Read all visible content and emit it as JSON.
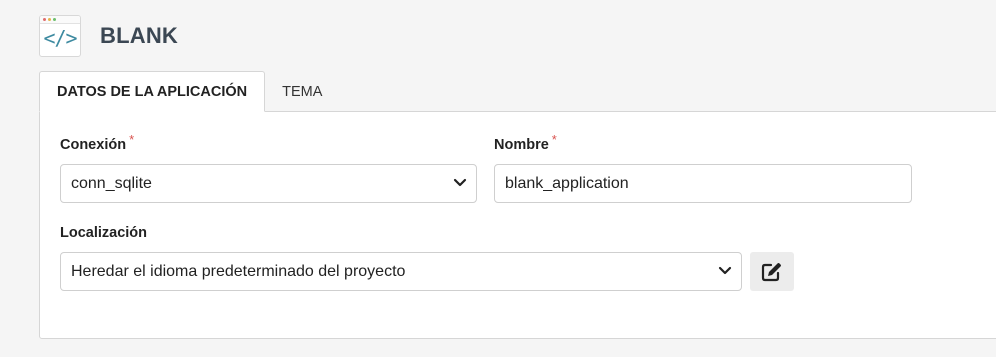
{
  "app": {
    "title": "BLANK",
    "icon": "code-brackets-icon",
    "icon_glyph": "</>"
  },
  "tabs": [
    {
      "label": "DATOS DE LA APLICACIÓN",
      "active": true
    },
    {
      "label": "TEMA",
      "active": false
    }
  ],
  "form": {
    "connection": {
      "label": "Conexión",
      "required": "*",
      "value": "conn_sqlite"
    },
    "name": {
      "label": "Nombre",
      "required": "*",
      "value": "blank_application"
    },
    "locale": {
      "label": "Localización",
      "value": "Heredar el idioma predeterminado del proyecto"
    }
  },
  "icons": {
    "select_arrow": "chevron-down-icon",
    "edit": "edit-icon"
  },
  "colors": {
    "accent_code": "#3d8aa0",
    "required": "#d9534f",
    "title": "#3b4753"
  }
}
